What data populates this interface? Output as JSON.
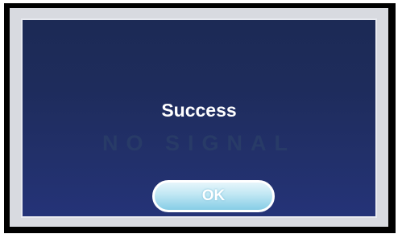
{
  "dialog": {
    "title": "Success",
    "ok_label": "OK"
  },
  "overlay": {
    "text": "NO SIGNAL"
  },
  "colors": {
    "dialog_background": "#1e2c5c",
    "dialog_border": "#e8eaf0",
    "button_fill": "#bfe6f3",
    "button_border": "#ffffff",
    "title_text": "#ffffff",
    "overlay_text": "#2a3e68"
  }
}
